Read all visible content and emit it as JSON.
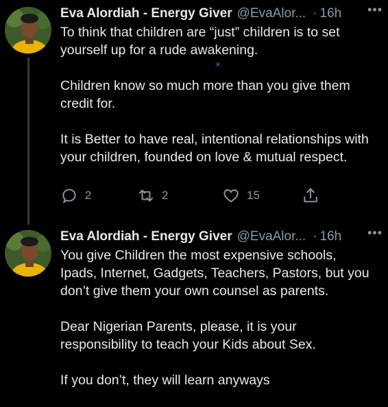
{
  "tweets": [
    {
      "author_name": "Eva Alordiah - Energy Giver",
      "handle": "@EvaAlor...",
      "separator": "·",
      "time": "16h",
      "more_icon": "more-horizontal-icon",
      "paragraphs": [
        "To think that children are “just” children is to set yourself up for a rude awakening.",
        "Children know so much more than you give them credit for.",
        "It is Better to have real, intentional relationships with your children, founded on love & mutual respect."
      ],
      "actions": {
        "reply_count": "2",
        "retweet_count": "2",
        "like_count": "15"
      }
    },
    {
      "author_name": "Eva Alordiah - Energy Giver",
      "handle": "@EvaAlor...",
      "separator": "·",
      "time": "16h",
      "more_icon": "more-horizontal-icon",
      "paragraphs": [
        "You give Children the most expensive schools, Ipads, Internet, Gadgets, Teachers, Pastors, but you don’t give them your own counsel as parents.",
        "Dear Nigerian Parents, please, it is your responsibility to teach your Kids about Sex.",
        "If you don’t, they will learn anyways"
      ]
    }
  ],
  "colors": {
    "background": "#000000",
    "text": "#e7e9ea",
    "secondary": "#8b98a5",
    "accent": "#1d9bf0"
  }
}
